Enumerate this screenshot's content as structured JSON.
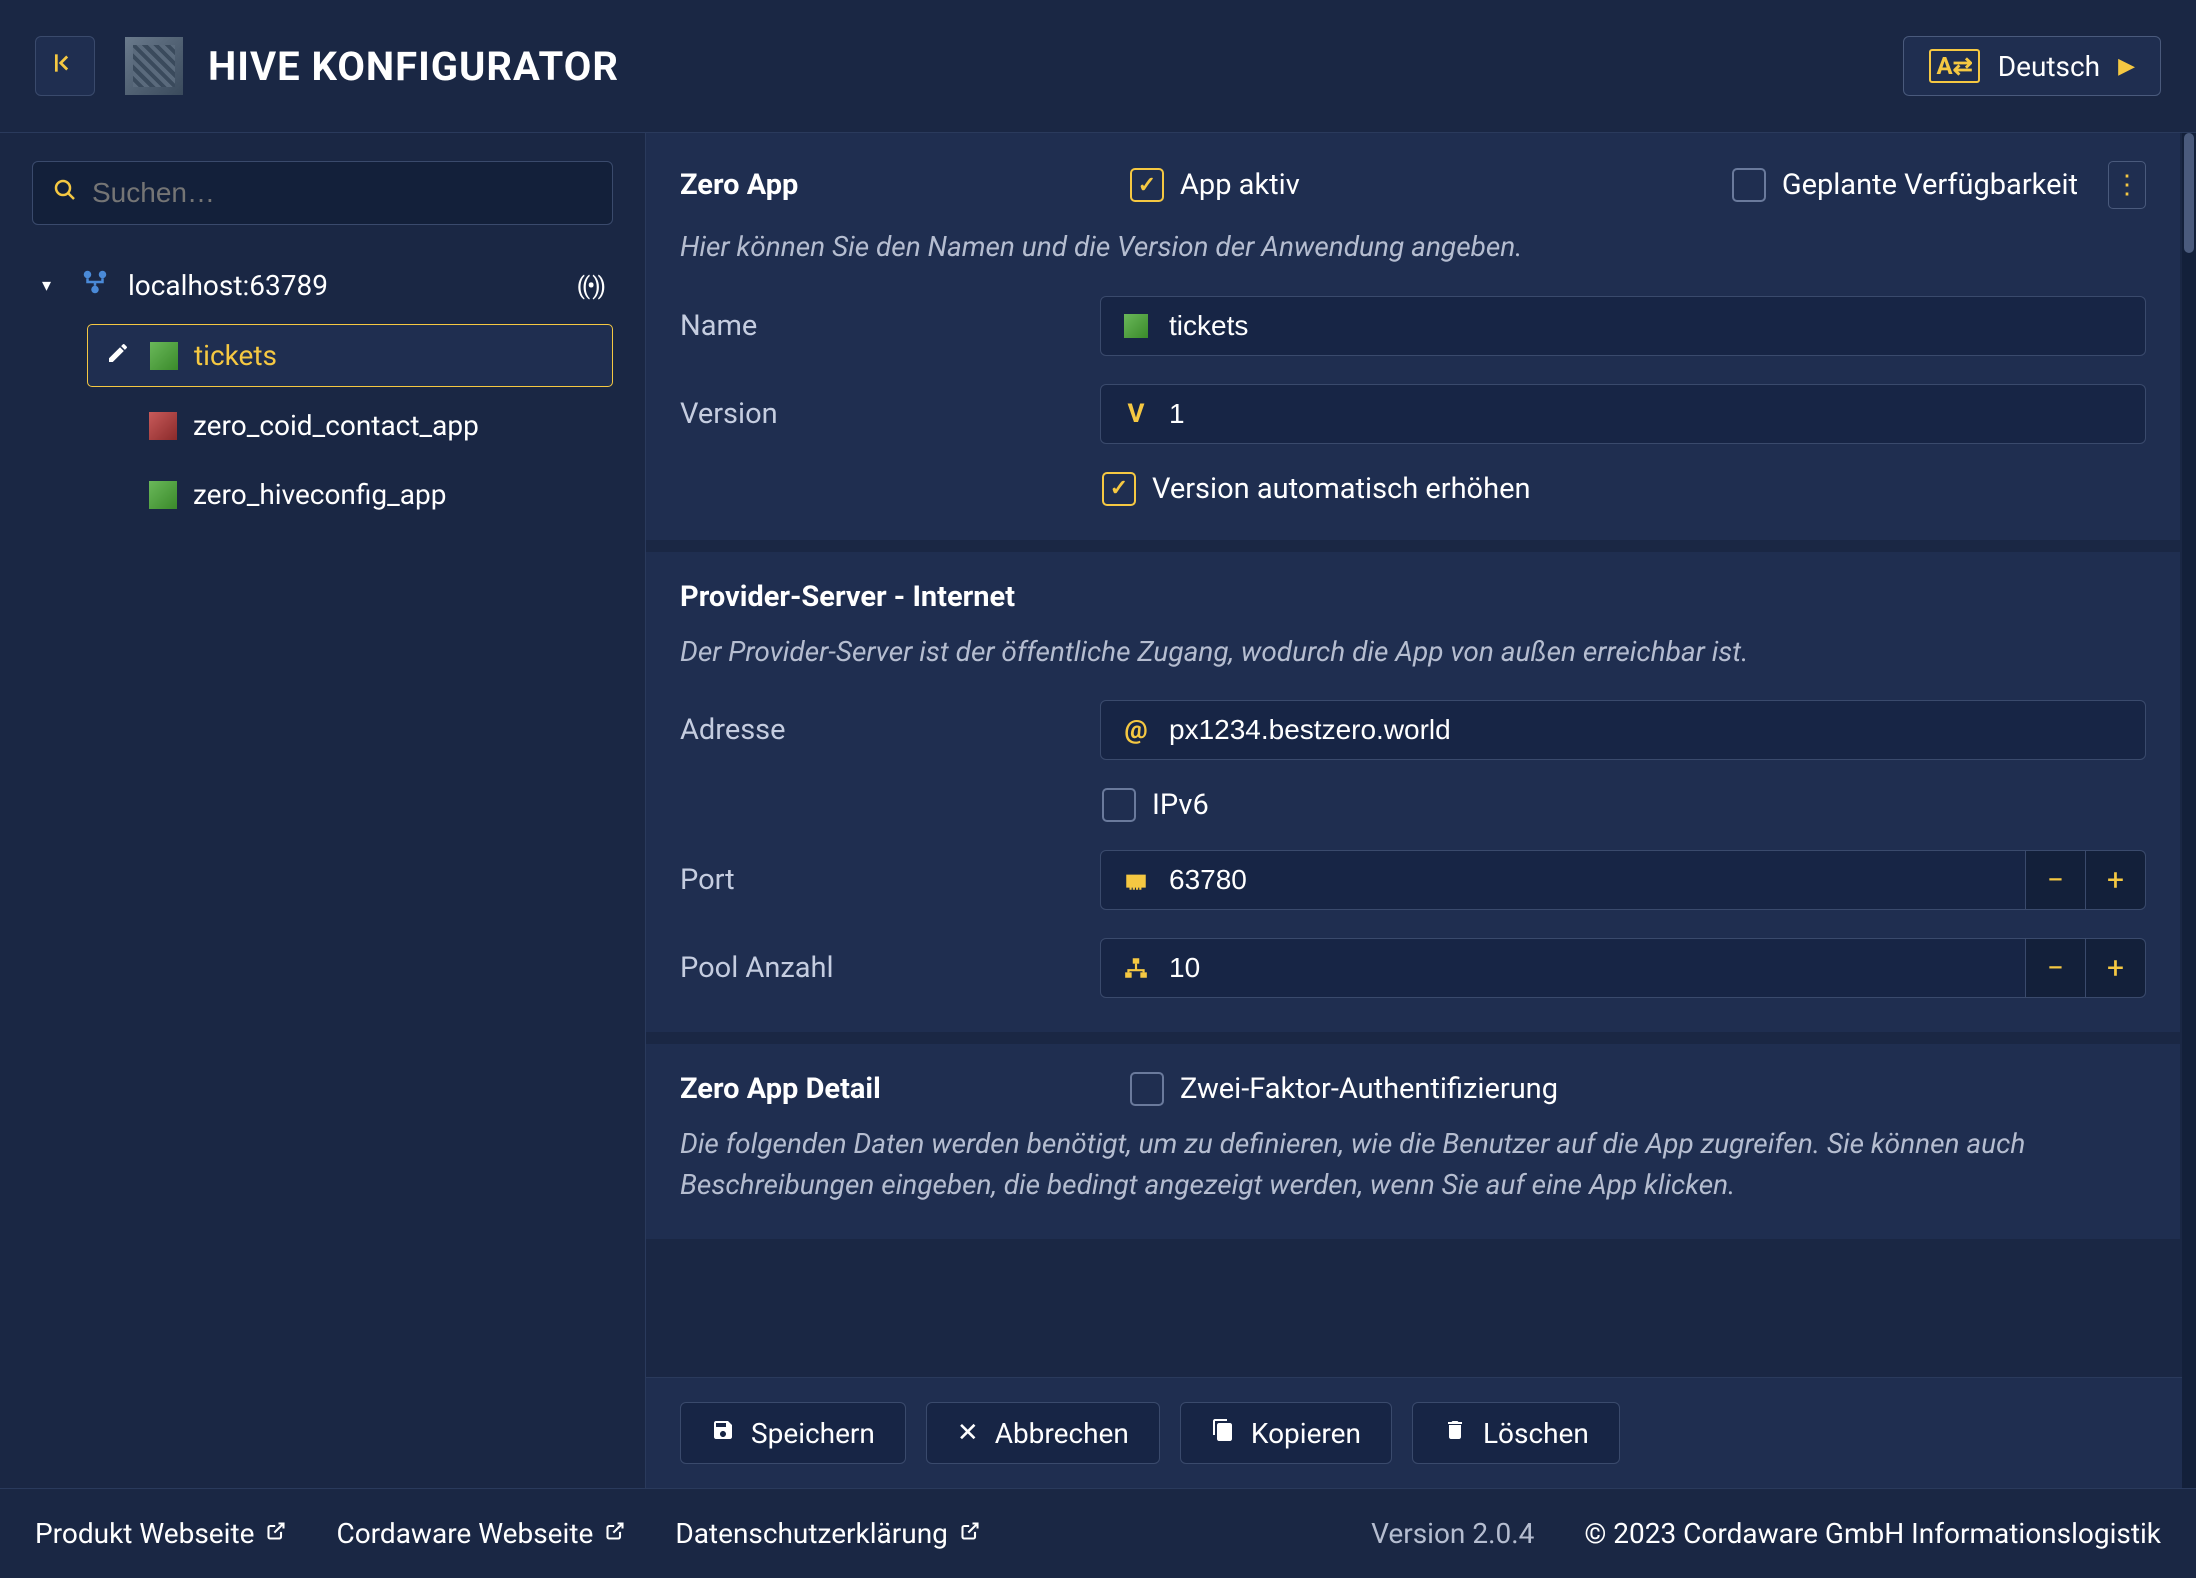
{
  "header": {
    "title": "HIVE KONFIGURATOR",
    "language": "Deutsch"
  },
  "sidebar": {
    "search_placeholder": "Suchen…",
    "root_label": "localhost:63789",
    "items": [
      {
        "label": "tickets",
        "color": "green",
        "active": true
      },
      {
        "label": "zero_coid_contact_app",
        "color": "red",
        "active": false
      },
      {
        "label": "zero_hiveconfig_app",
        "color": "green",
        "active": false
      }
    ]
  },
  "section_zero_app": {
    "title": "Zero App",
    "app_active_label": "App aktiv",
    "scheduled_label": "Geplante Verfügbarkeit",
    "description": "Hier können Sie den Namen und die Version der Anwendung angeben.",
    "name_label": "Name",
    "name_value": "tickets",
    "version_label": "Version",
    "version_value": "1",
    "auto_version_label": "Version automatisch erhöhen"
  },
  "section_provider": {
    "title": "Provider-Server - Internet",
    "description": "Der Provider-Server ist der öffentliche Zugang, wodurch die App von außen erreichbar ist.",
    "address_label": "Adresse",
    "address_value": "px1234.bestzero.world",
    "ipv6_label": "IPv6",
    "port_label": "Port",
    "port_value": "63780",
    "pool_label": "Pool Anzahl",
    "pool_value": "10"
  },
  "section_detail": {
    "title": "Zero App Detail",
    "twofa_label": "Zwei-Faktor-Authentifizierung",
    "description": "Die folgenden Daten werden benötigt, um zu definieren, wie die Benutzer auf die App zugreifen. Sie können auch Beschreibungen eingeben, die bedingt angezeigt werden, wenn Sie auf eine App klicken."
  },
  "actions": {
    "save": "Speichern",
    "cancel": "Abbrechen",
    "copy": "Kopieren",
    "delete": "Löschen"
  },
  "footer": {
    "product_site": "Produkt Webseite",
    "cordaware_site": "Cordaware Webseite",
    "privacy": "Datenschutzerklärung",
    "version": "Version 2.0.4",
    "copyright": "© 2023 Cordaware GmbH Informationslogistik"
  }
}
